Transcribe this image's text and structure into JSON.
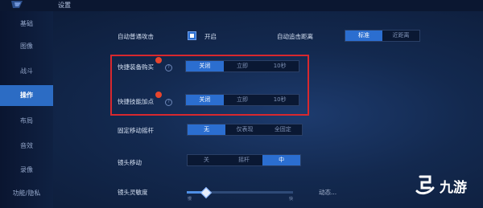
{
  "header": {
    "title": "设置"
  },
  "sidebar": {
    "items": [
      {
        "label": "基础"
      },
      {
        "label": "图像"
      },
      {
        "label": "战斗"
      },
      {
        "label": "操作"
      },
      {
        "label": "布局"
      },
      {
        "label": "音效"
      },
      {
        "label": "录像"
      },
      {
        "label": "功能/隐私"
      }
    ],
    "active_index": 3
  },
  "settings": {
    "auto_attack": {
      "label": "自动普通攻击",
      "checkbox_label": "开启",
      "checked": true
    },
    "auto_chase": {
      "label": "自动追击距离",
      "options": [
        "标准",
        "近距离"
      ],
      "selected": "标准"
    },
    "quick_buy": {
      "label": "快捷装备购买",
      "badge": "?",
      "options": [
        "关闭",
        "立即",
        "10秒"
      ],
      "selected": "关闭"
    },
    "quick_skill": {
      "label": "快捷技能加点",
      "badge": "?",
      "options": [
        "关闭",
        "立即",
        "10秒"
      ],
      "selected": "关闭"
    },
    "fixed_joystick": {
      "label": "固定移动摇杆",
      "options": [
        "无",
        "仅表现",
        "全固定"
      ],
      "selected": "无"
    },
    "camera_move": {
      "label": "镜头移动",
      "options": [
        "关",
        "摇杆",
        "中"
      ],
      "selected": "中"
    },
    "camera_sensitivity": {
      "label": "镜头灵敏度",
      "tick_min": "慢",
      "tick_max": "快",
      "level": 0.18,
      "side_label": "动态..."
    }
  },
  "watermark": {
    "text": "九游"
  },
  "colors": {
    "accent": "#2b6ed0",
    "highlight_box": "#d8282e"
  }
}
